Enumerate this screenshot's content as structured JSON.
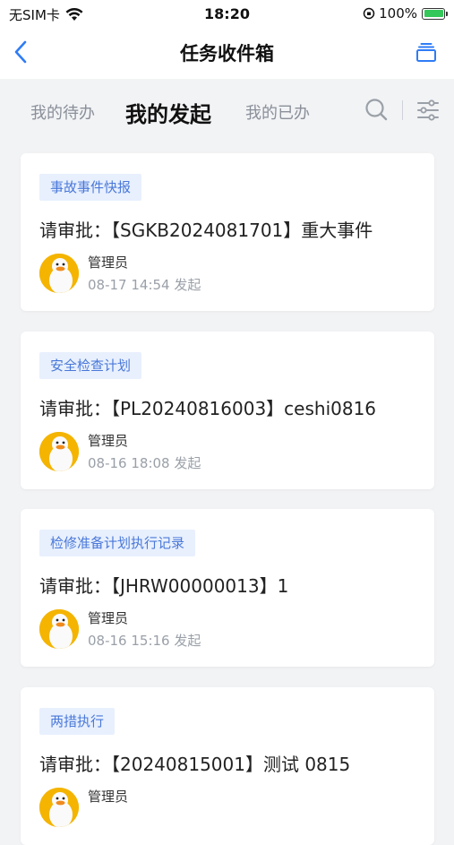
{
  "status_bar": {
    "carrier": "无SIM卡",
    "time": "18:20",
    "battery": "100%",
    "icons": [
      "wifi-icon",
      "orientation-lock-icon",
      "battery-charging-icon"
    ]
  },
  "nav": {
    "title": "任务收件箱",
    "icons": [
      "back-chevron-icon",
      "stack-icon"
    ]
  },
  "tabs": {
    "todo": "我的待办",
    "initiated": "我的发起",
    "done": "我的已办",
    "active": "我的发起",
    "icons": [
      "search-icon",
      "filter-icon"
    ]
  },
  "accent_color": "#4a78d8",
  "cards": [
    {
      "tag": "事故事件快报",
      "title": "请审批：【SGKB2024081701】重大事件",
      "user": "管理员",
      "time": "08-17 14:54 发起"
    },
    {
      "tag": "安全检查计划",
      "title": "请审批：【PL20240816003】ceshi0816",
      "user": "管理员",
      "time": "08-16 18:08 发起"
    },
    {
      "tag": "检修准备计划执行记录",
      "title": "请审批：【JHRW00000013】1",
      "user": "管理员",
      "time": "08-16 15:16 发起"
    },
    {
      "tag": "两措执行",
      "title": "请审批：【20240815001】测试 0815",
      "user": "管理员",
      "time": ""
    }
  ]
}
